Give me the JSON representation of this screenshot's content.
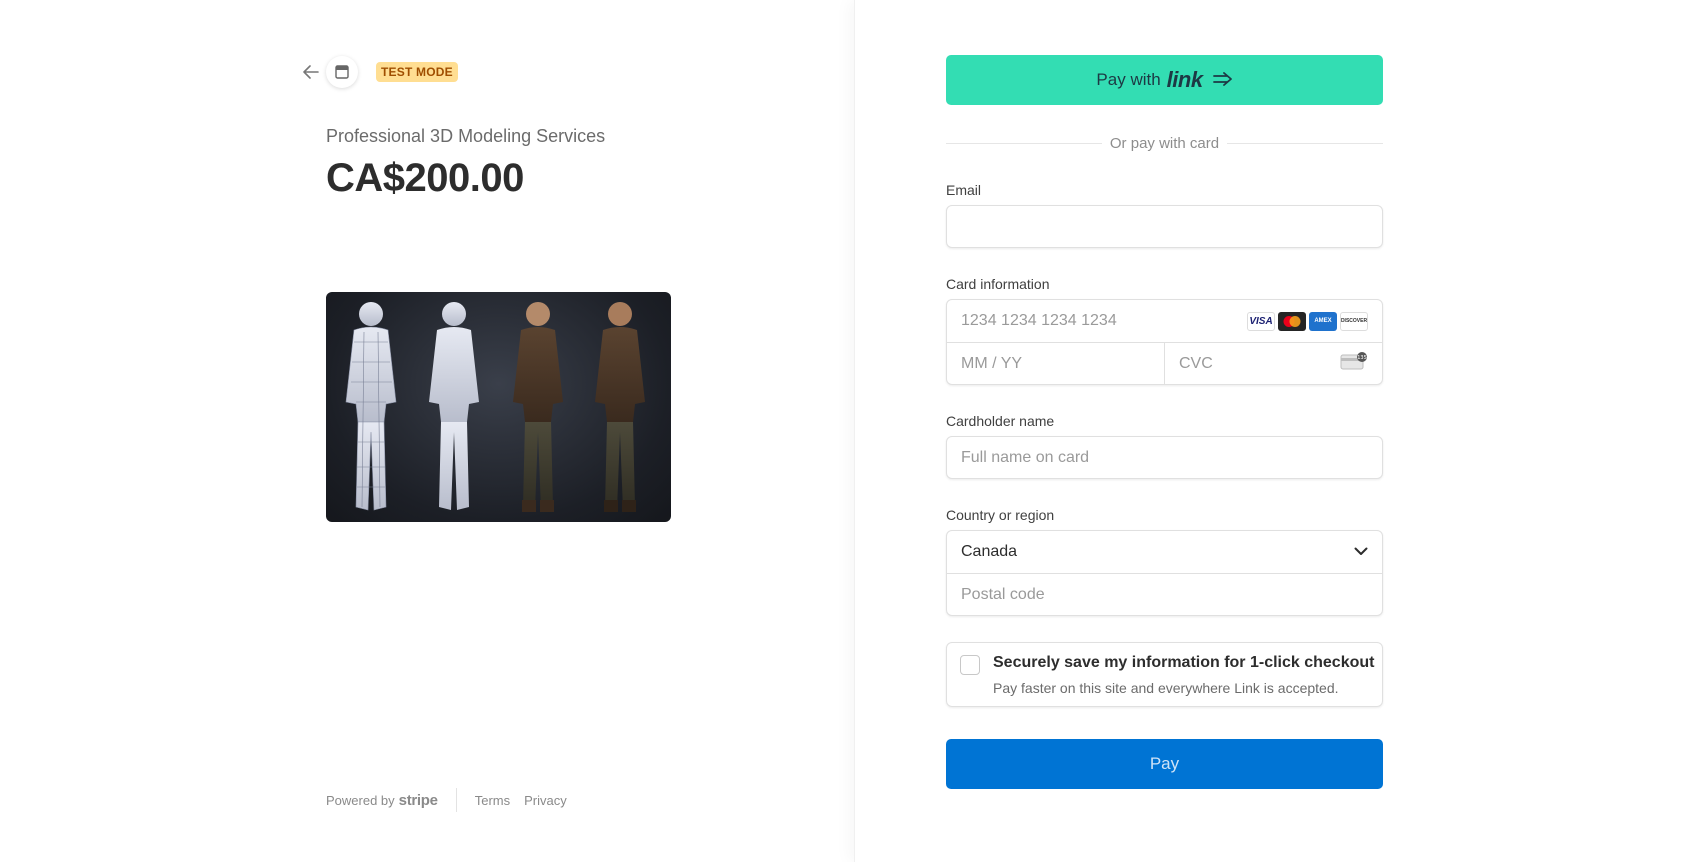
{
  "header": {
    "test_mode_label": "TEST MODE"
  },
  "product": {
    "name": "Professional 3D Modeling Services",
    "price": "CA$200.00"
  },
  "footer": {
    "powered_by": "Powered by",
    "brand": "stripe",
    "terms": "Terms",
    "privacy": "Privacy"
  },
  "checkout": {
    "link_button_prefix": "Pay with",
    "link_button_brand": "link",
    "divider_text": "Or pay with card",
    "email_label": "Email",
    "email_value": "",
    "card_label": "Card information",
    "card_number_placeholder": "1234 1234 1234 1234",
    "expiry_placeholder": "MM / YY",
    "cvc_placeholder": "CVC",
    "card_brands": [
      "VISA",
      "mastercard",
      "AMEX",
      "DISCOVER"
    ],
    "cardholder_label": "Cardholder name",
    "cardholder_placeholder": "Full name on card",
    "country_label": "Country or region",
    "country_value": "Canada",
    "postal_placeholder": "Postal code",
    "save_title": "Securely save my information for 1-click checkout",
    "save_subtitle": "Pay faster on this site and everywhere Link is accepted.",
    "pay_button": "Pay"
  },
  "colors": {
    "link_green": "#33ddb3",
    "pay_blue": "#0074d4",
    "test_badge_bg": "#ffde92"
  }
}
